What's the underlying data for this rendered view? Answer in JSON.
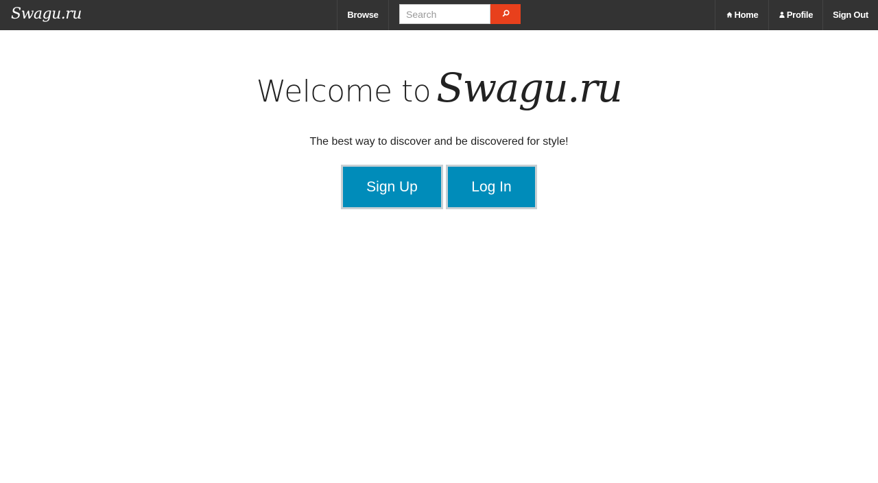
{
  "navbar": {
    "brand": "Swagu.ru",
    "browse_label": "Browse",
    "search": {
      "placeholder": "Search",
      "value": "",
      "button_icon": "search-icon"
    },
    "home": {
      "label": "Home",
      "icon": "home-icon"
    },
    "profile": {
      "label": "Profile",
      "icon": "user-icon"
    },
    "signout_label": "Sign Out"
  },
  "hero": {
    "title_prefix": "Welcome to",
    "title_brand": "Swagu.ru",
    "tagline": "The best way to discover and be discovered for style!",
    "signup_label": "Sign Up",
    "login_label": "Log In"
  },
  "colors": {
    "navbar_bg": "#333333",
    "search_button": "#e8401c",
    "primary_button": "#008cba"
  }
}
